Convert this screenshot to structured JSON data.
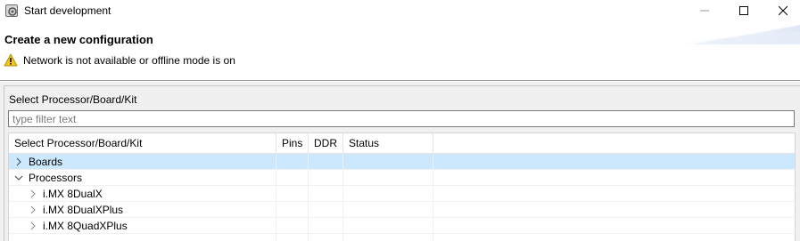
{
  "window": {
    "title": "Start development",
    "icon": "eclipse-app-icon"
  },
  "banner": {
    "title": "Create a new configuration",
    "warning_icon": "warning-triangle-icon",
    "warning_text": "Network is not available or offline mode is on"
  },
  "selector": {
    "label": "Select Processor/Board/Kit",
    "filter_placeholder": "type filter text",
    "filter_value": ""
  },
  "table": {
    "columns": [
      "Select Processor/Board/Kit",
      "Pins",
      "DDR",
      "Status"
    ],
    "rows": [
      {
        "label": "Boards",
        "level": 0,
        "expanded": false,
        "selected": true
      },
      {
        "label": "Processors",
        "level": 0,
        "expanded": true,
        "selected": false
      },
      {
        "label": "i.MX 8DualX",
        "level": 1,
        "expanded": false,
        "selected": false
      },
      {
        "label": "i.MX 8DualXPlus",
        "level": 1,
        "expanded": false,
        "selected": false
      },
      {
        "label": "i.MX 8QuadXPlus",
        "level": 1,
        "expanded": false,
        "selected": false
      }
    ]
  },
  "colors": {
    "selection": "#cce8ff",
    "warning": "#f2c811",
    "background": "#f0f0f0"
  }
}
